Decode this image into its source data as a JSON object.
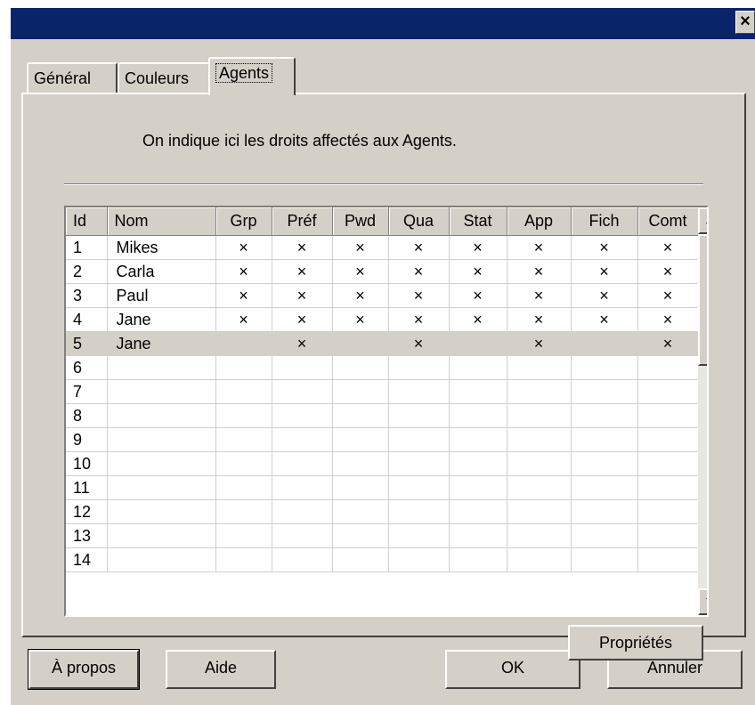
{
  "window": {
    "close_glyph": "×"
  },
  "tabs": [
    "Général",
    "Couleurs",
    "Agents"
  ],
  "active_tab": "Agents",
  "description": "On indique ici les droits affectés aux Agents.",
  "table": {
    "columns": [
      "Id",
      "Nom",
      "Grp",
      "Préf",
      "Pwd",
      "Qua",
      "Stat",
      "App",
      "Fich",
      "Comt"
    ],
    "mark": "×",
    "rows": [
      {
        "id": "1",
        "nom": "Mikes",
        "rights": [
          true,
          true,
          true,
          true,
          true,
          true,
          true,
          true
        ]
      },
      {
        "id": "2",
        "nom": "Carla",
        "rights": [
          true,
          true,
          true,
          true,
          true,
          true,
          true,
          true
        ]
      },
      {
        "id": "3",
        "nom": "Paul",
        "rights": [
          true,
          true,
          true,
          true,
          true,
          true,
          true,
          true
        ]
      },
      {
        "id": "4",
        "nom": "Jane",
        "rights": [
          true,
          true,
          true,
          true,
          true,
          true,
          true,
          true
        ]
      },
      {
        "id": "5",
        "nom": "Jane",
        "rights": [
          false,
          true,
          false,
          true,
          false,
          true,
          false,
          true
        ],
        "selected": true
      },
      {
        "id": "6",
        "nom": "",
        "rights": [
          false,
          false,
          false,
          false,
          false,
          false,
          false,
          false
        ]
      },
      {
        "id": "7",
        "nom": "",
        "rights": [
          false,
          false,
          false,
          false,
          false,
          false,
          false,
          false
        ]
      },
      {
        "id": "8",
        "nom": "",
        "rights": [
          false,
          false,
          false,
          false,
          false,
          false,
          false,
          false
        ]
      },
      {
        "id": "9",
        "nom": "",
        "rights": [
          false,
          false,
          false,
          false,
          false,
          false,
          false,
          false
        ]
      },
      {
        "id": "10",
        "nom": "",
        "rights": [
          false,
          false,
          false,
          false,
          false,
          false,
          false,
          false
        ]
      },
      {
        "id": "11",
        "nom": "",
        "rights": [
          false,
          false,
          false,
          false,
          false,
          false,
          false,
          false
        ]
      },
      {
        "id": "12",
        "nom": "",
        "rights": [
          false,
          false,
          false,
          false,
          false,
          false,
          false,
          false
        ]
      },
      {
        "id": "13",
        "nom": "",
        "rights": [
          false,
          false,
          false,
          false,
          false,
          false,
          false,
          false
        ]
      },
      {
        "id": "14",
        "nom": "",
        "rights": [
          false,
          false,
          false,
          false,
          false,
          false,
          false,
          false
        ]
      }
    ]
  },
  "buttons": {
    "properties": "Propriétés",
    "about": "À propos",
    "help": "Aide",
    "ok": "OK",
    "cancel": "Annuler"
  },
  "colors": {
    "titlebar": "#0a246a",
    "face": "#d4d0c8",
    "selected_row": "#d4d0c8"
  }
}
